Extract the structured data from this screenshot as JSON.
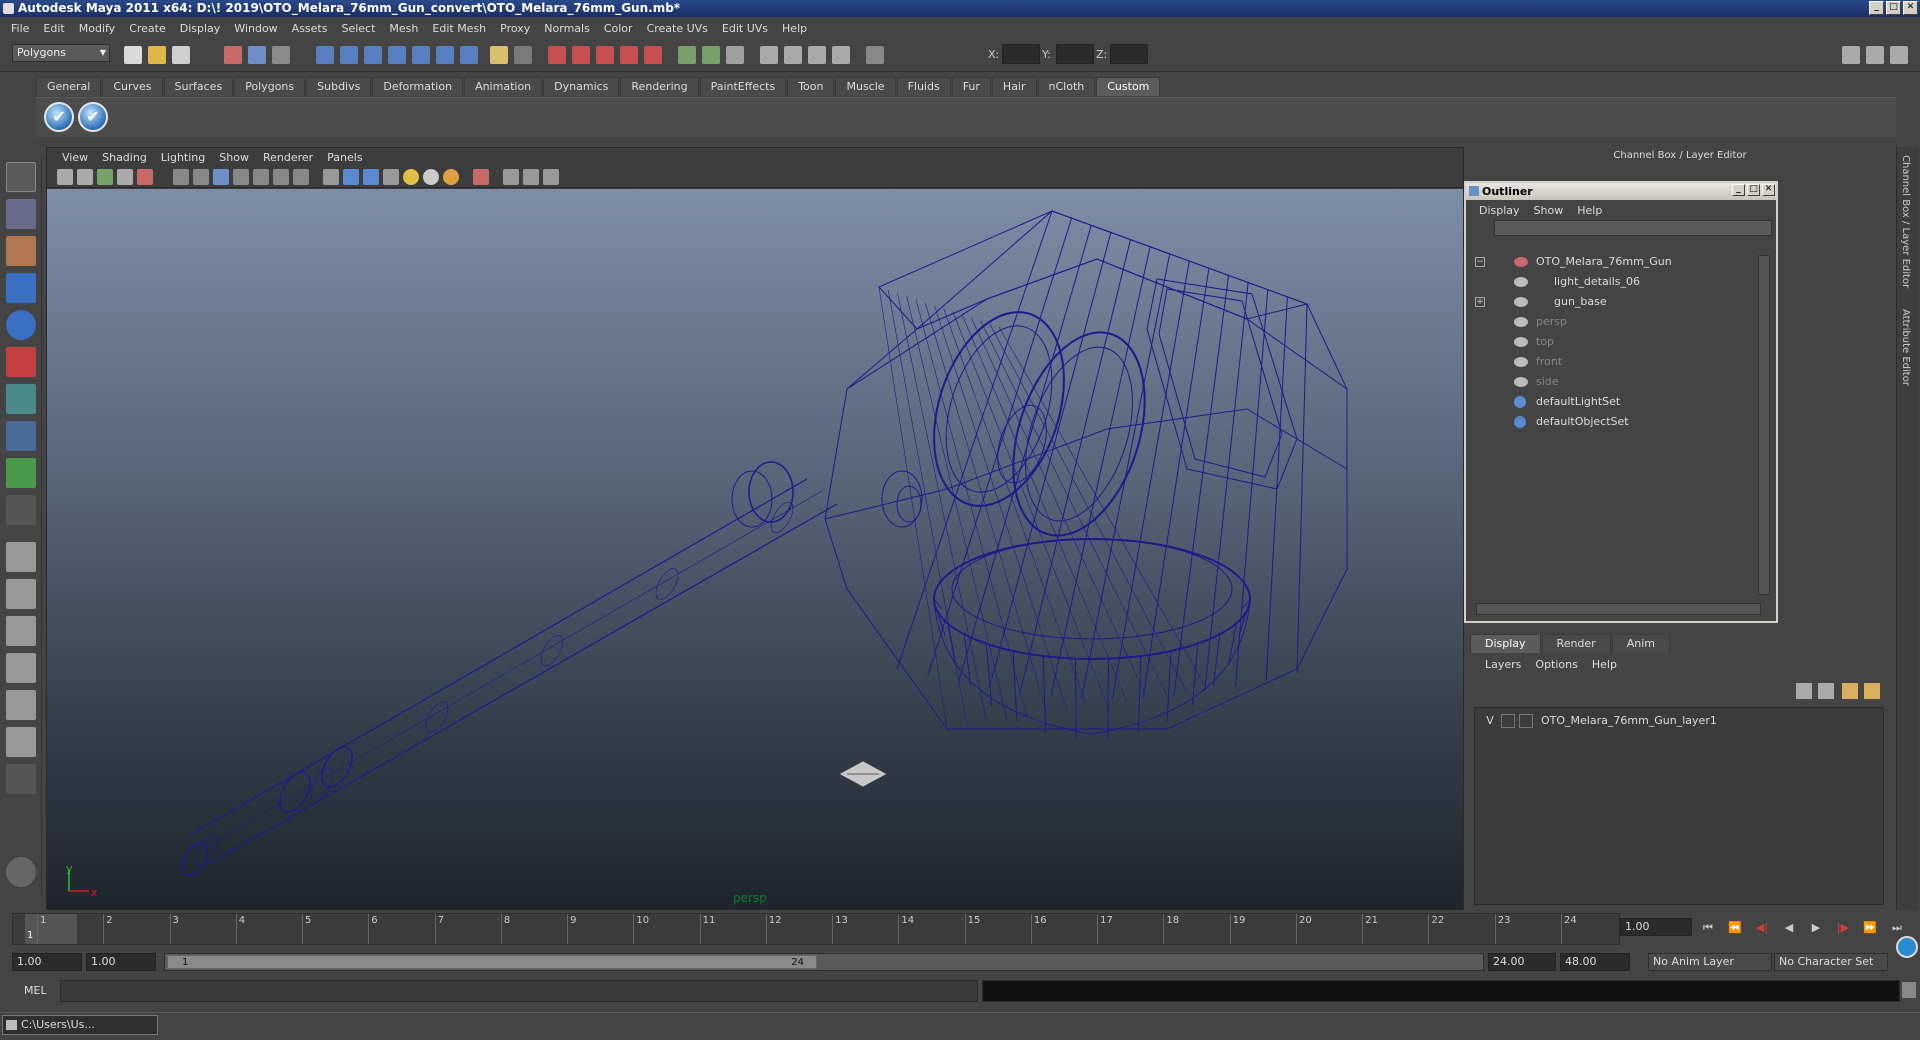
{
  "window": {
    "title": "Autodesk Maya 2011 x64: D:\\! 2019\\OTO_Melara_76mm_Gun_convert\\OTO_Melara_76mm_Gun.mb*",
    "minimize": "_",
    "maximize": "□",
    "close": "✕"
  },
  "menubar": [
    "File",
    "Edit",
    "Modify",
    "Create",
    "Display",
    "Window",
    "Assets",
    "Select",
    "Mesh",
    "Edit Mesh",
    "Proxy",
    "Normals",
    "Color",
    "Create UVs",
    "Edit UVs",
    "Help"
  ],
  "statusline": {
    "mode": "Polygons",
    "x_label": "X:",
    "y_label": "Y:",
    "z_label": "Z:"
  },
  "shelf": {
    "tabs": [
      "General",
      "Curves",
      "Surfaces",
      "Polygons",
      "Subdivs",
      "Deformation",
      "Animation",
      "Dynamics",
      "Rendering",
      "PaintEffects",
      "Toon",
      "Muscle",
      "Fluids",
      "Fur",
      "Hair",
      "nCloth",
      "Custom"
    ],
    "active_tab": "Custom",
    "check_glyph": "✔"
  },
  "viewport": {
    "menu": [
      "View",
      "Shading",
      "Lighting",
      "Show",
      "Renderer",
      "Panels"
    ],
    "camera": "persp",
    "axis_y": "y",
    "axis_x": "x",
    "wire_color": "#1b1b8e"
  },
  "channel_box": {
    "header": "Channel Box / Layer Editor"
  },
  "outliner": {
    "title": "Outliner",
    "menu": [
      "Display",
      "Show",
      "Help"
    ],
    "items": [
      {
        "label": "OTO_Melara_76mm_Gun",
        "dim": false
      },
      {
        "label": "light_details_06",
        "dim": false
      },
      {
        "label": "gun_base",
        "dim": false
      },
      {
        "label": "persp",
        "dim": true
      },
      {
        "label": "top",
        "dim": true
      },
      {
        "label": "front",
        "dim": true
      },
      {
        "label": "side",
        "dim": true
      },
      {
        "label": "defaultLightSet",
        "dim": false
      },
      {
        "label": "defaultObjectSet",
        "dim": false
      }
    ],
    "collapse_glyph": "−",
    "expand_glyph": "+"
  },
  "layer_editor": {
    "tabs": [
      "Display",
      "Render",
      "Anim"
    ],
    "active_tab": "Display",
    "menu": [
      "Layers",
      "Options",
      "Help"
    ],
    "layer": {
      "visible": "V",
      "name": "OTO_Melara_76mm_Gun_layer1"
    }
  },
  "side_tabs": [
    "Channel Box / Layer Editor",
    "Attribute Editor"
  ],
  "timeline": {
    "ticks": [
      "1",
      "2",
      "3",
      "4",
      "5",
      "6",
      "7",
      "8",
      "9",
      "10",
      "11",
      "12",
      "13",
      "14",
      "15",
      "16",
      "17",
      "18",
      "19",
      "20",
      "21",
      "22",
      "23",
      "24"
    ],
    "current_marker": "1",
    "current_frame": "1.00",
    "playback": [
      "⏮",
      "⏪",
      "◀|",
      "◀",
      "▶",
      "|▶",
      "⏩",
      "⏭"
    ]
  },
  "range": {
    "start": "1.00",
    "playback_start": "1.00",
    "handle_start": "1",
    "handle_end": "24",
    "playback_end": "24.00",
    "end": "48.00",
    "anim_layer": "No Anim Layer",
    "character_set": "No Character Set"
  },
  "command_line": {
    "label": "MEL"
  },
  "taskbar": {
    "item": "C:\\Users\\Us..."
  }
}
